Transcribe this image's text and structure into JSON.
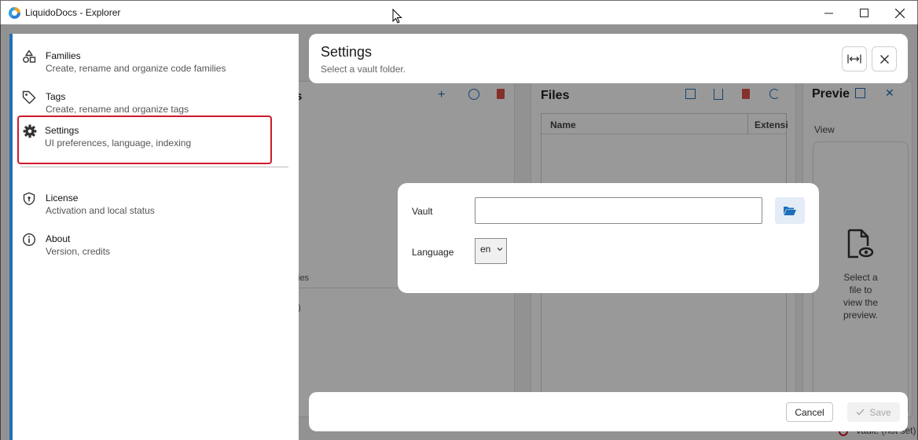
{
  "window": {
    "title": "LiquidoDocs - Explorer",
    "minimize": "—",
    "maximize": "☐",
    "close": "✕"
  },
  "background": {
    "files_title": "Files",
    "preview_title": "Previe",
    "column_name": "Name",
    "column_extension": "Extensi",
    "view_label": "View",
    "left_fragment_s": "s",
    "left_fragment_ies": "ies",
    "left_fragment_paren": ")",
    "preview_empty": [
      "Select a",
      "file to",
      "view the",
      "preview."
    ],
    "status_text": "Vault: (not set)"
  },
  "drawer": {
    "items": [
      {
        "title": "Families",
        "subtitle": "Create, rename and organize code families",
        "icon": "shapes-icon"
      },
      {
        "title": "Tags",
        "subtitle": "Create, rename and organize tags",
        "icon": "tag-icon"
      },
      {
        "title": "Settings",
        "subtitle": "UI preferences, language, indexing",
        "icon": "gear-icon",
        "selected": true
      },
      {
        "title": "License",
        "subtitle": "Activation and local status",
        "icon": "shield-icon"
      },
      {
        "title": "About",
        "subtitle": "Version, credits",
        "icon": "info-icon"
      }
    ],
    "accent_color": "#1f6fb8",
    "highlight_color": "#d0192b"
  },
  "settings": {
    "title": "Settings",
    "subtitle": "Select a vault folder.",
    "vault_label": "Vault",
    "vault_value": "",
    "language_label": "Language",
    "language_value": "en"
  },
  "footer": {
    "cancel_label": "Cancel",
    "save_label": "Save"
  }
}
